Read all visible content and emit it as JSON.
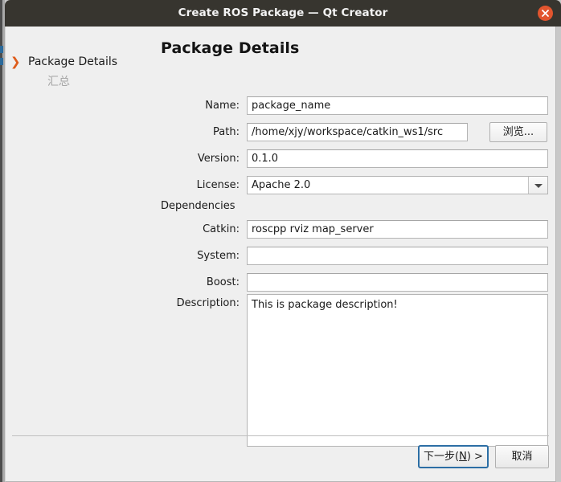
{
  "window": {
    "title": "Create ROS Package — Qt Creator",
    "close_icon": "close-icon"
  },
  "sidebar": {
    "items": [
      {
        "label": "Package Details",
        "active": true,
        "chevron": "❯"
      },
      {
        "label": "汇总",
        "active": false
      }
    ]
  },
  "main": {
    "page_title": "Package Details",
    "fields": {
      "name": {
        "label": "Name:",
        "value": "package_name",
        "placeholder": ""
      },
      "path": {
        "label": "Path:",
        "value": "/home/xjy/workspace/catkin_ws1/src",
        "placeholder": ""
      },
      "browse": {
        "label": "浏览..."
      },
      "version": {
        "label": "Version:",
        "value": "0.1.0",
        "placeholder": ""
      },
      "license": {
        "label": "License:",
        "value": "Apache 2.0",
        "arrow": "chevron-down-icon"
      },
      "dependencies_heading": "Dependencies",
      "catkin": {
        "label": "Catkin:",
        "value": "roscpp rviz map_server",
        "placeholder": ""
      },
      "system": {
        "label": "System:",
        "value": "",
        "placeholder": ""
      },
      "boost": {
        "label": "Boost:",
        "value": "",
        "placeholder": ""
      },
      "description": {
        "label": "Description:",
        "value": "This is package description!",
        "placeholder": ""
      }
    }
  },
  "footer": {
    "next_prefix": "下一步(",
    "next_mnemonic": "N",
    "next_suffix": ") >",
    "cancel_label": "取消"
  },
  "colors": {
    "titlebar": "#37352f",
    "close": "#e2552e",
    "dialog_bg": "#efefef",
    "accent_chevron": "#de5c1c",
    "focus_ring": "#2c6ea5",
    "field_bg": "#ffffff",
    "field_border": "#b4b4b4"
  }
}
